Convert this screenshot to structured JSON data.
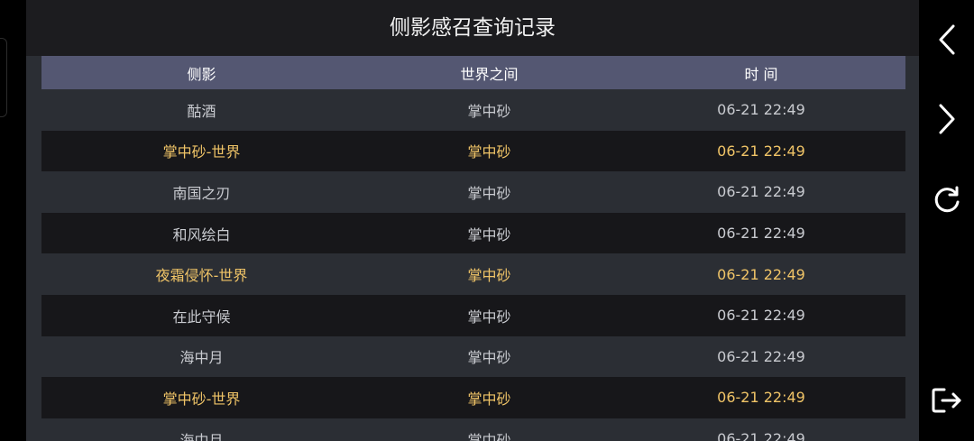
{
  "title": "侧影感召查询记录",
  "columns": [
    "侧影",
    "世界之间",
    "时 间"
  ],
  "rows": [
    {
      "shadow": "酤酒",
      "world": "掌中砂",
      "time": "06-21 22:49",
      "highlight": false
    },
    {
      "shadow": "掌中砂-世界",
      "world": "掌中砂",
      "time": "06-21 22:49",
      "highlight": true
    },
    {
      "shadow": "南国之刃",
      "world": "掌中砂",
      "time": "06-21 22:49",
      "highlight": false
    },
    {
      "shadow": "和风绘白",
      "world": "掌中砂",
      "time": "06-21 22:49",
      "highlight": false
    },
    {
      "shadow": "夜霜侵怀-世界",
      "world": "掌中砂",
      "time": "06-21 22:49",
      "highlight": true
    },
    {
      "shadow": "在此守候",
      "world": "掌中砂",
      "time": "06-21 22:49",
      "highlight": false
    },
    {
      "shadow": "海中月",
      "world": "掌中砂",
      "time": "06-21 22:49",
      "highlight": false
    },
    {
      "shadow": "掌中砂-世界",
      "world": "掌中砂",
      "time": "06-21 22:49",
      "highlight": true
    },
    {
      "shadow": "海中月",
      "world": "掌中砂",
      "time": "06-21 22:49",
      "highlight": false
    }
  ],
  "controls": {
    "prev_icon": "chevron-left-icon",
    "next_icon": "chevron-right-icon",
    "refresh_icon": "refresh-icon",
    "exit_icon": "exit-icon"
  },
  "colors": {
    "highlight": "#f0c467",
    "header": "#545772",
    "row_light": "#2b2e34",
    "row_dark": "#17171a"
  }
}
